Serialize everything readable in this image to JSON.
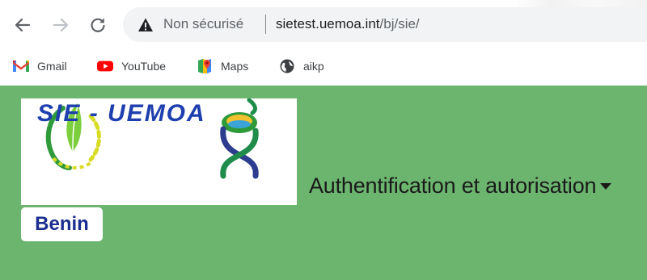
{
  "browser": {
    "security_label": "Non sécurisé",
    "url_host": "sietest.uemoa.int",
    "url_path": "/bj/sie/",
    "bookmarks": [
      {
        "label": "Gmail",
        "icon": "gmail-icon"
      },
      {
        "label": "YouTube",
        "icon": "youtube-icon"
      },
      {
        "label": "Maps",
        "icon": "maps-icon"
      },
      {
        "label": "aikp",
        "icon": "globe-icon"
      }
    ]
  },
  "header": {
    "logo_text": "SIE - UEMOA",
    "nav_menu_label": "Authentification et autorisation",
    "country_label": "Benin"
  },
  "colors": {
    "header_bg": "#6cb56f",
    "country_text": "#1b2e8f",
    "logo_text": "#1e3fae"
  }
}
